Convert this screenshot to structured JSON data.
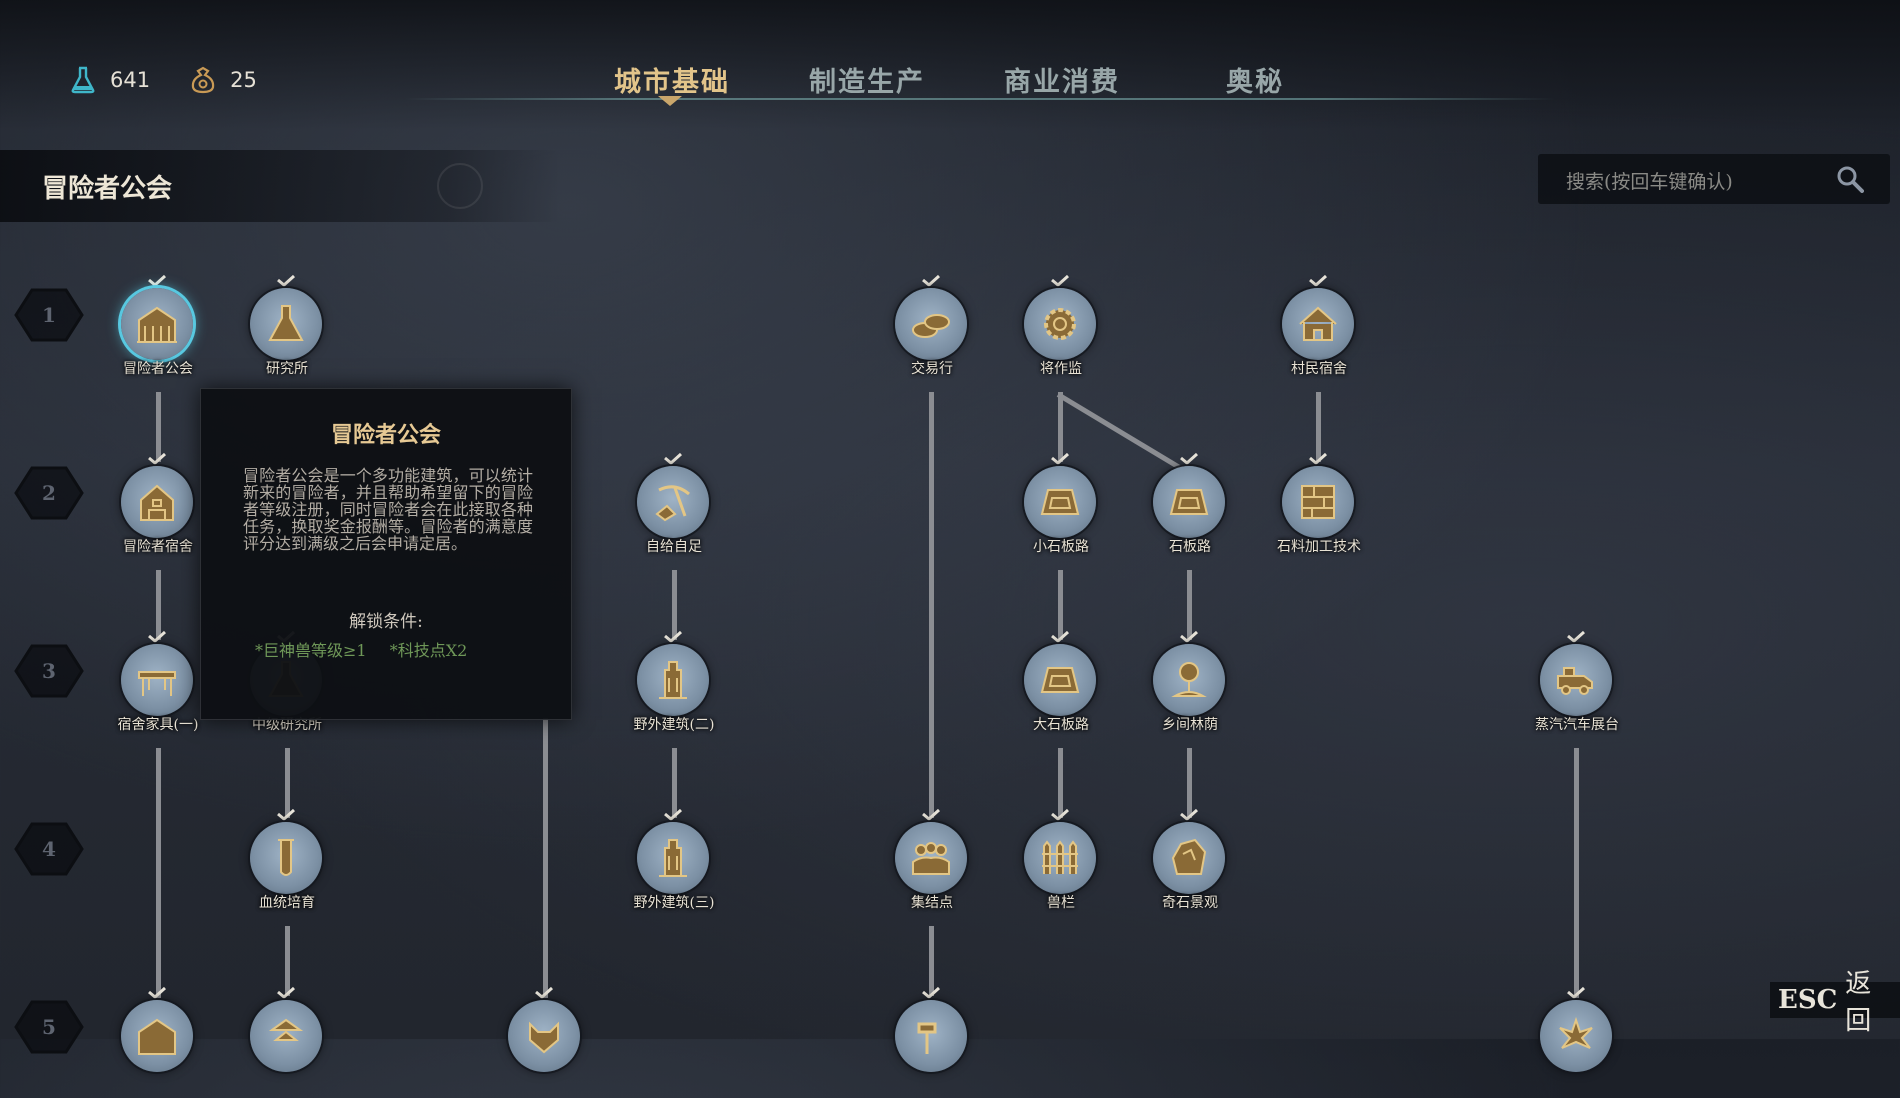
{
  "resources": [
    {
      "icon": "flask-icon",
      "value": "641"
    },
    {
      "icon": "sack-icon",
      "value": "25"
    }
  ],
  "tabs": [
    {
      "label": "城市基础",
      "active": true
    },
    {
      "label": "制造生产",
      "active": false
    },
    {
      "label": "商业消费",
      "active": false
    },
    {
      "label": "奥秘",
      "active": false
    }
  ],
  "category": {
    "title": "冒险者公会"
  },
  "search": {
    "placeholder": "搜索(按回车键确认)"
  },
  "rows": [
    "1",
    "2",
    "3",
    "4",
    "5"
  ],
  "nodes": [
    {
      "label": "冒险者公会",
      "icon": "guild-hall-icon",
      "selected": true
    },
    {
      "label": "研究所",
      "icon": "flask-icon"
    },
    {
      "label": "交易行",
      "icon": "coins-icon"
    },
    {
      "label": "将作监",
      "icon": "gear-icon"
    },
    {
      "label": "村民宿舍",
      "icon": "house-icon"
    },
    {
      "label": "冒险者宿舍",
      "icon": "dorm-icon"
    },
    {
      "label": "自给自足",
      "icon": "pickaxe-icon"
    },
    {
      "label": "小石板路",
      "icon": "road-icon"
    },
    {
      "label": "石板路",
      "icon": "road-icon"
    },
    {
      "label": "石料加工技术",
      "icon": "stone-block-icon"
    },
    {
      "label": "宿舍家具(一)",
      "icon": "table-icon"
    },
    {
      "label": "中级研究所",
      "icon": "flask-icon"
    },
    {
      "label": "野外建筑(二)",
      "icon": "tower-icon"
    },
    {
      "label": "大石板路",
      "icon": "road-icon"
    },
    {
      "label": "乡间林荫",
      "icon": "tree-icon"
    },
    {
      "label": "蒸汽汽车展台",
      "icon": "steam-car-icon"
    },
    {
      "label": "血统培育",
      "icon": "test-tube-icon"
    },
    {
      "label": "野外建筑(三)",
      "icon": "tower-icon"
    },
    {
      "label": "集结点",
      "icon": "crowd-icon"
    },
    {
      "label": "兽栏",
      "icon": "fence-icon"
    },
    {
      "label": "奇石景观",
      "icon": "rock-icon"
    }
  ],
  "tooltip": {
    "title": "冒险者公会",
    "body": "冒险者公会是一个多功能建筑，可以统计新来的冒险者，并且帮助希望留下的冒险者等级注册，同时冒险者会在此接取各种任务，换取奖金报酬等。冒险者的满意度评分达到满级之后会申请定居。",
    "unlock_title": "解锁条件:",
    "unlock_conditions": [
      "*巨神兽等级≥1",
      "*科技点X2"
    ]
  },
  "esc": {
    "key": "ESC",
    "label": "返回"
  },
  "colors": {
    "accent": "#e2c48a",
    "selection": "#58c8e0",
    "condition": "#6f9858"
  }
}
